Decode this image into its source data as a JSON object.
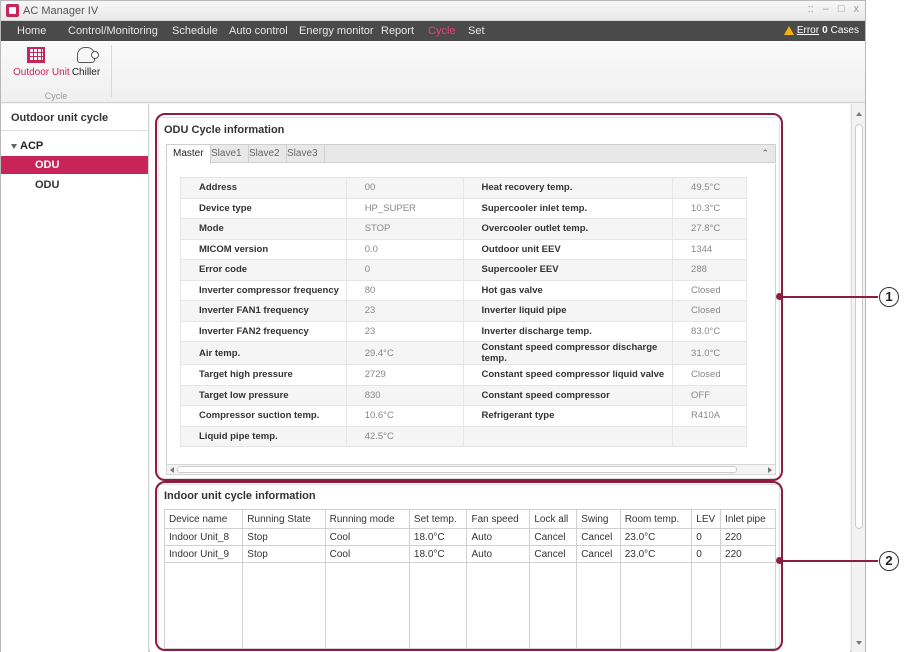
{
  "window": {
    "title": "AC Manager IV",
    "controls": [
      "::",
      "–",
      "□",
      "x"
    ]
  },
  "menu": {
    "items": [
      "Home",
      "Control/Monitoring",
      "Schedule",
      "Auto control",
      "Energy monitor",
      "Report",
      "Cycle",
      "Set"
    ],
    "active": "Cycle",
    "error_label": "Error",
    "error_count": "0",
    "error_suffix": "Cases"
  },
  "ribbon": {
    "buttons": [
      {
        "label": "Outdoor Unit",
        "icon": "outdoor-unit-icon",
        "active": true
      },
      {
        "label": "Chiller",
        "icon": "chiller-icon",
        "active": false
      }
    ],
    "group_label": "Cycle"
  },
  "sidebar": {
    "title": "Outdoor unit cycle",
    "tree": {
      "root": "ACP",
      "children": [
        {
          "label": "ODU",
          "selected": true
        },
        {
          "label": "ODU",
          "selected": false
        }
      ]
    }
  },
  "odu_panel": {
    "title": "ODU Cycle information",
    "tabs": [
      "Master",
      "Slave1",
      "Slave2",
      "Slave3"
    ],
    "active_tab": "Master",
    "rows": [
      {
        "k1": "Address",
        "v1": "00",
        "k2": "Heat recovery temp.",
        "v2": "49.5°C"
      },
      {
        "k1": "Device type",
        "v1": "HP_SUPER",
        "k2": "Supercooler inlet temp.",
        "v2": "10.3°C"
      },
      {
        "k1": "Mode",
        "v1": "STOP",
        "k2": "Overcooler outlet temp.",
        "v2": "27.8°C"
      },
      {
        "k1": "MICOM version",
        "v1": "0.0",
        "k2": "Outdoor unit EEV",
        "v2": "1344"
      },
      {
        "k1": "Error code",
        "v1": "0",
        "k2": "Supercooler EEV",
        "v2": "288"
      },
      {
        "k1": "Inverter compressor frequency",
        "v1": "80",
        "k2": "Hot gas valve",
        "v2": "Closed"
      },
      {
        "k1": "Inverter FAN1 frequency",
        "v1": "23",
        "k2": "Inverter liquid pipe",
        "v2": "Closed"
      },
      {
        "k1": "Inverter FAN2 frequency",
        "v1": "23",
        "k2": "Inverter discharge temp.",
        "v2": "83.0°C"
      },
      {
        "k1": "Air temp.",
        "v1": "29.4°C",
        "k2": "Constant speed compressor discharge temp.",
        "v2": "31.0°C"
      },
      {
        "k1": "Target high pressure",
        "v1": "2729",
        "k2": "Constant speed compressor liquid valve",
        "v2": "Closed"
      },
      {
        "k1": "Target low pressure",
        "v1": "830",
        "k2": "Constant speed compressor",
        "v2": "OFF"
      },
      {
        "k1": "Compressor suction temp.",
        "v1": "10.6°C",
        "k2": "Refrigerant type",
        "v2": "R410A"
      },
      {
        "k1": "Liquid pipe temp.",
        "v1": "42.5°C",
        "k2": "",
        "v2": ""
      }
    ]
  },
  "idu_panel": {
    "title": "Indoor unit cycle information",
    "columns": [
      "Device name",
      "Running State",
      "Running mode",
      "Set temp.",
      "Fan speed",
      "Lock all",
      "Swing",
      "Room temp.",
      "LEV",
      "Inlet pipe"
    ],
    "rows": [
      [
        "Indoor Unit_8",
        "Stop",
        "Cool",
        "18.0°C",
        "Auto",
        "Cancel",
        "Cancel",
        "23.0°C",
        "0",
        "220"
      ],
      [
        "Indoor Unit_9",
        "Stop",
        "Cool",
        "18.0°C",
        "Auto",
        "Cancel",
        "Cancel",
        "23.0°C",
        "0",
        "220"
      ]
    ]
  },
  "callouts": [
    "1",
    "2"
  ],
  "colors": {
    "accent": "#c8245a",
    "menubar": "#4a4a4a",
    "callout": "#8c1d3e",
    "warning": "#f4b400"
  }
}
